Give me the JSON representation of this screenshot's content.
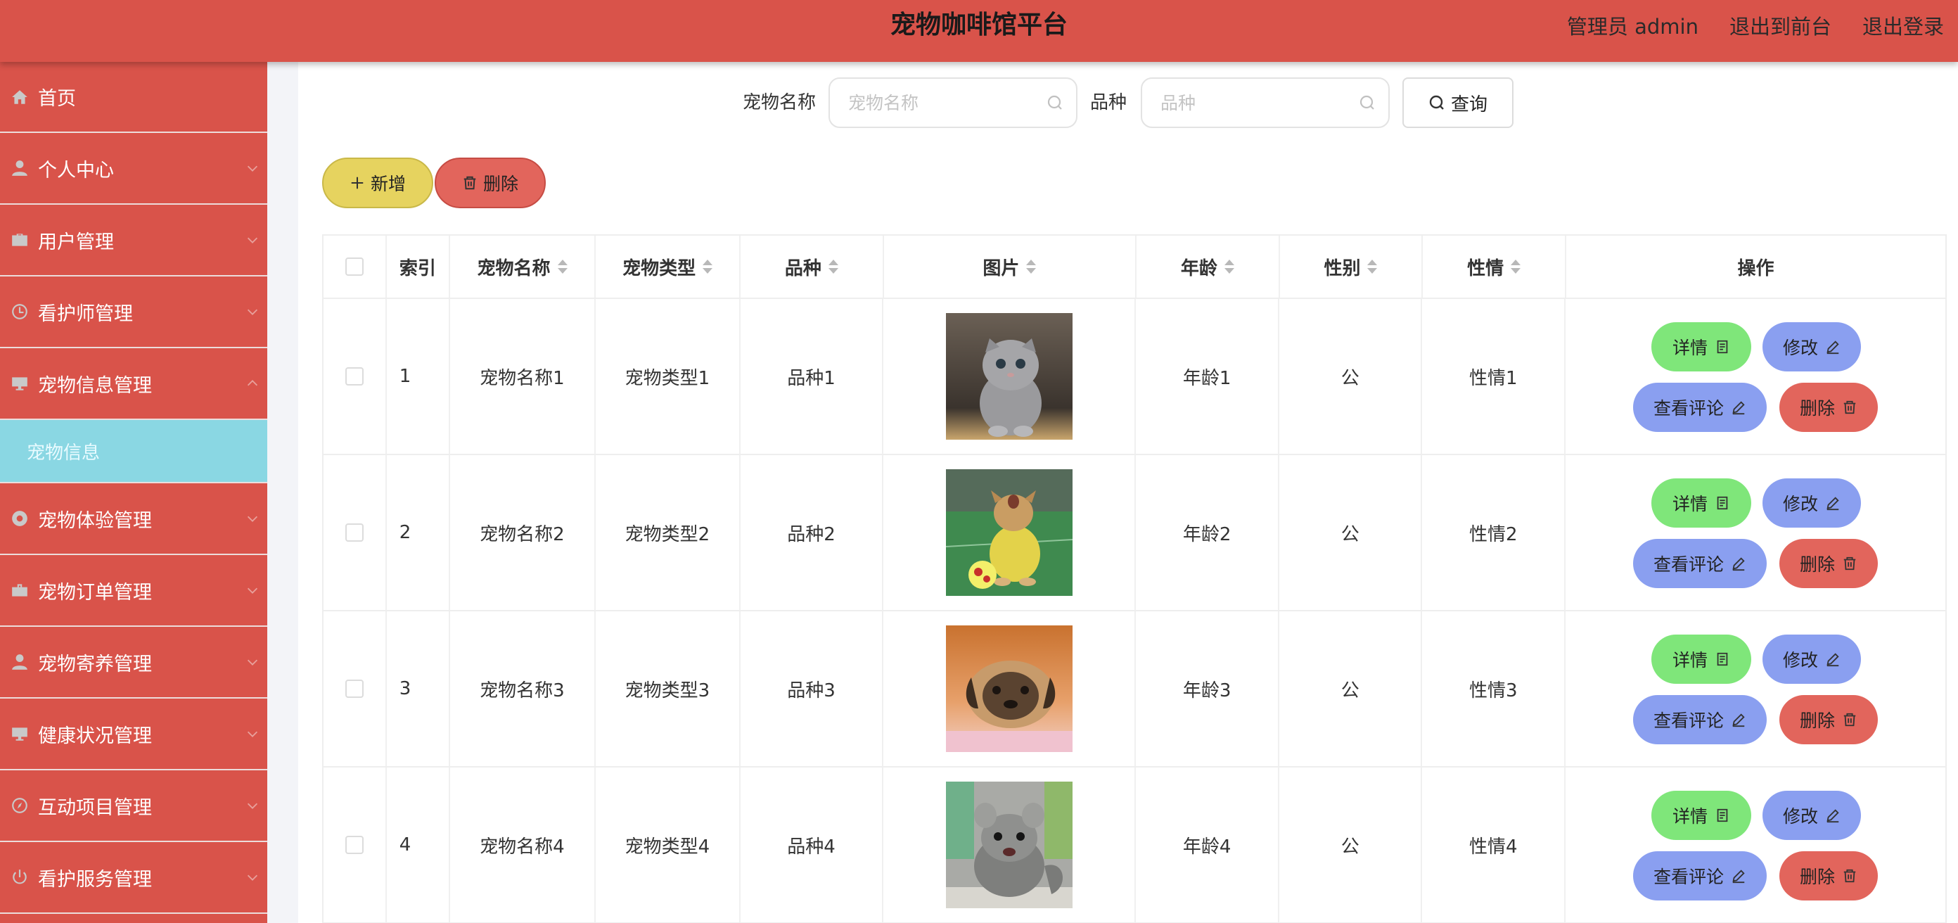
{
  "header": {
    "title": "宠物咖啡馆平台",
    "links": [
      "管理员 admin",
      "退出到前台",
      "退出登录"
    ]
  },
  "sidebar": {
    "items": [
      {
        "label": "首页",
        "icon": "home-icon",
        "expanded": false
      },
      {
        "label": "个人中心",
        "icon": "user-icon",
        "expanded": false
      },
      {
        "label": "用户管理",
        "icon": "briefcase-icon",
        "expanded": false
      },
      {
        "label": "看护师管理",
        "icon": "clock-icon",
        "expanded": false
      },
      {
        "label": "宠物信息管理",
        "icon": "monitor-icon",
        "expanded": true
      },
      {
        "label": "宠物体验管理",
        "icon": "lifebuoy-icon",
        "expanded": false
      },
      {
        "label": "宠物订单管理",
        "icon": "toolbox-icon",
        "expanded": false
      },
      {
        "label": "宠物寄养管理",
        "icon": "user-icon",
        "expanded": false
      },
      {
        "label": "健康状况管理",
        "icon": "monitor-icon",
        "expanded": false
      },
      {
        "label": "互动项目管理",
        "icon": "compass-icon",
        "expanded": false
      },
      {
        "label": "看护服务管理",
        "icon": "power-icon",
        "expanded": false
      }
    ],
    "active_submenu": "宠物信息"
  },
  "search": {
    "name_label": "宠物名称",
    "name_placeholder": "宠物名称",
    "name_value": "",
    "breed_label": "品种",
    "breed_placeholder": "品种",
    "breed_value": "",
    "query_label": "查询"
  },
  "actions": {
    "add_label": "新增",
    "delete_label": "删除"
  },
  "table": {
    "columns": [
      "索引",
      "宠物名称",
      "宠物类型",
      "品种",
      "图片",
      "年龄",
      "性别",
      "性情",
      "操作"
    ],
    "rows": [
      {
        "index": "1",
        "name": "宠物名称1",
        "type": "宠物类型1",
        "breed": "品种1",
        "image": "kitten-photo",
        "age": "年龄1",
        "sex": "公",
        "temperament": "性情1"
      },
      {
        "index": "2",
        "name": "宠物名称2",
        "type": "宠物类型2",
        "breed": "品种2",
        "image": "dog-with-ball-photo",
        "age": "年龄2",
        "sex": "公",
        "temperament": "性情2"
      },
      {
        "index": "3",
        "name": "宠物名称3",
        "type": "宠物类型3",
        "breed": "品种3",
        "image": "pug-photo",
        "age": "年龄3",
        "sex": "公",
        "temperament": "性情3"
      },
      {
        "index": "4",
        "name": "宠物名称4",
        "type": "宠物类型4",
        "breed": "品种4",
        "image": "chinchilla-photo",
        "age": "年龄4",
        "sex": "公",
        "temperament": "性情4"
      }
    ],
    "row_actions": {
      "detail": "详情",
      "edit": "修改",
      "review": "查看评论",
      "delete": "删除"
    }
  },
  "colors": {
    "header_bg": "#d9534a",
    "sidebar_bg": "#d9534a",
    "submenu_active_bg": "#8ad7e3",
    "add_button": "#e6d35f",
    "delete_button": "#e2655c",
    "detail_button": "#7fe67a",
    "edit_button": "#8a9ff0"
  }
}
